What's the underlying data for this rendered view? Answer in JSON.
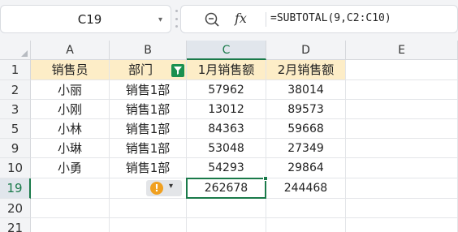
{
  "name_box": {
    "ref": "C19"
  },
  "formula_bar": {
    "fx_label": "fx",
    "formula": "=SUBTOTAL(9,C2:C10)"
  },
  "columns": [
    "A",
    "B",
    "C",
    "D",
    "E"
  ],
  "active_column": "C",
  "rows": [
    "1",
    "2",
    "3",
    "5",
    "9",
    "10",
    "19",
    "20",
    "21"
  ],
  "active_row": "19",
  "header_row": [
    "销售员",
    "部门",
    "1月销售额",
    "2月销售额",
    ""
  ],
  "data_rows": [
    [
      "小丽",
      "销售1部",
      "57962",
      "38014",
      ""
    ],
    [
      "小刚",
      "销售1部",
      "13012",
      "89573",
      ""
    ],
    [
      "小林",
      "销售1部",
      "84363",
      "59668",
      ""
    ],
    [
      "小琳",
      "销售1部",
      "53048",
      "27349",
      ""
    ],
    [
      "小勇",
      "销售1部",
      "54293",
      "29864",
      ""
    ],
    [
      "",
      "",
      "262678",
      "244468",
      ""
    ],
    [
      "",
      "",
      "",
      "",
      ""
    ],
    [
      "",
      "",
      "",
      "",
      ""
    ]
  ],
  "error_tag": {
    "symbol": "!"
  },
  "colors": {
    "header_fill": "#fdedc7",
    "selection": "#1a7a4a",
    "filter_button": "#1a9050",
    "warning": "#f0a020"
  }
}
